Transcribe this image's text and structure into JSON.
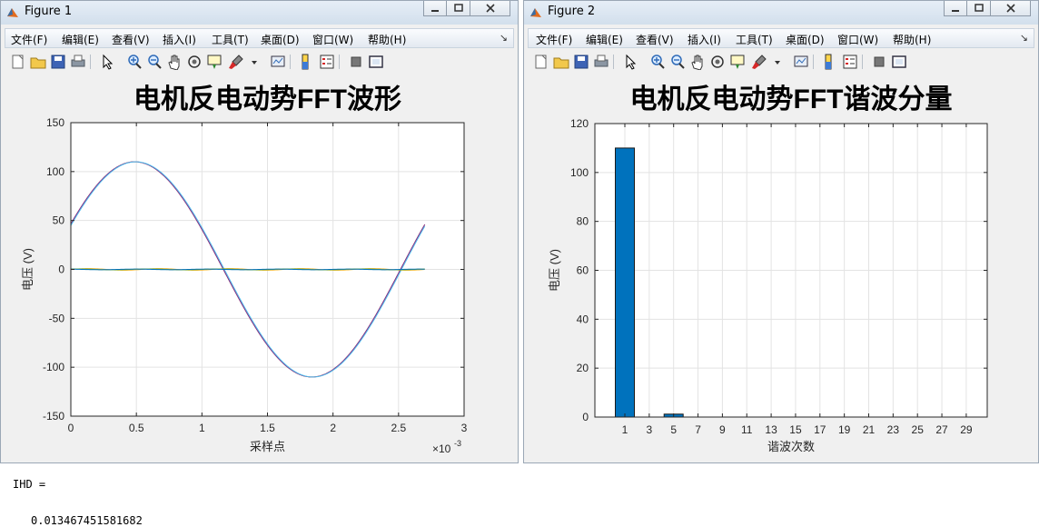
{
  "windows": [
    {
      "title": "Figure 1",
      "menu": [
        "文件(F)",
        "编辑(E)",
        "查看(V)",
        "插入(I)",
        "工具(T)",
        "桌面(D)",
        "窗口(W)",
        "帮助(H)"
      ],
      "menu_chevron": "↘"
    },
    {
      "title": "Figure 2",
      "menu": [
        "文件(F)",
        "编辑(E)",
        "查看(V)",
        "插入(I)",
        "工具(T)",
        "桌面(D)",
        "窗口(W)",
        "帮助(H)"
      ],
      "menu_chevron": "↘"
    }
  ],
  "toolbar_icons": [
    "new-figure-icon",
    "open-file-icon",
    "save-icon",
    "print-icon",
    "edit-pointer-icon",
    "zoom-in-icon",
    "zoom-out-icon",
    "pan-icon",
    "rotate-3d-icon",
    "data-cursor-icon",
    "brush-icon",
    "brush-dropdown-icon",
    "link-plot-icon",
    "colorbar-icon",
    "legend-icon",
    "hide-plot-tools-icon",
    "show-plot-tools-icon"
  ],
  "colors": {
    "bar": "#0072bd",
    "series": [
      "#0072bd",
      "#d95319",
      "#edb120",
      "#7e2f8e",
      "#77ac30",
      "#4dbeee"
    ]
  },
  "chart_data": [
    {
      "type": "line",
      "title": "电机反电动势FFT波形",
      "xlabel": "采样点",
      "ylabel": "电压 (V)",
      "x_exponent_label": "×10",
      "x_exponent": "-3",
      "xlim": [
        0,
        0.003
      ],
      "ylim": [
        -150,
        150
      ],
      "xticks": [
        0,
        0.0005,
        0.001,
        0.0015,
        0.002,
        0.0025,
        0.003
      ],
      "xtick_labels": [
        "0",
        "0.5",
        "1",
        "1.5",
        "2",
        "2.5",
        "3"
      ],
      "yticks": [
        -150,
        -100,
        -50,
        0,
        50,
        100,
        150
      ],
      "ytick_labels": [
        "-150",
        "-100",
        "-50",
        "0",
        "50",
        "100",
        "150"
      ],
      "grid": true,
      "x_end": 0.0027,
      "series": [
        {
          "fundamental_amplitude": 110,
          "frequency_hz": 370,
          "phase_deg": 25,
          "color": "#d95319"
        },
        {
          "fundamental_amplitude": 110,
          "frequency_hz": 370,
          "phase_deg": 25,
          "color": "#7e2f8e"
        },
        {
          "fundamental_amplitude": 110,
          "frequency_hz": 370,
          "phase_deg": 24,
          "color": "#4dbeee"
        },
        {
          "fundamental_amplitude": 0.8,
          "frequency_hz": 1850,
          "phase_deg": 0,
          "color": "#edb120"
        },
        {
          "fundamental_amplitude": 0.5,
          "frequency_hz": 1850,
          "phase_deg": 60,
          "color": "#77ac30"
        },
        {
          "fundamental_amplitude": 0.3,
          "frequency_hz": 1850,
          "phase_deg": 120,
          "color": "#0072bd"
        }
      ]
    },
    {
      "type": "bar",
      "title": "电机反电动势FFT谐波分量",
      "xlabel": "谐波次数",
      "ylabel": "电压 (V)",
      "categories": [
        1,
        3,
        5,
        7,
        9,
        11,
        13,
        15,
        17,
        19,
        21,
        23,
        25,
        27,
        29
      ],
      "values": [
        110,
        0,
        1.2,
        0,
        0,
        0,
        0,
        0,
        0,
        0,
        0,
        0,
        0,
        0,
        0
      ],
      "ylim": [
        0,
        120
      ],
      "yticks": [
        0,
        20,
        40,
        60,
        80,
        100,
        120
      ],
      "grid": true
    }
  ],
  "command_window": {
    "var_line": "IHD =",
    "value_line": "0.013467451581682"
  }
}
